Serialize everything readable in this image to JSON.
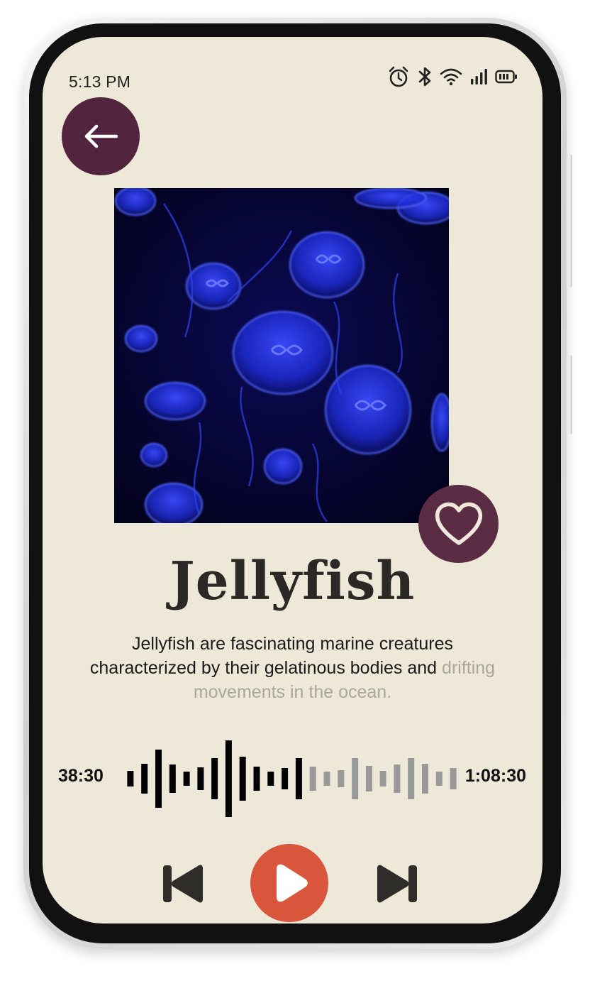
{
  "status_bar": {
    "time": "5:13 PM",
    "icons": [
      "alarm-icon",
      "bluetooth-icon",
      "wifi-icon",
      "signal-icon",
      "battery-icon"
    ]
  },
  "track": {
    "title": "Jellyfish",
    "description_start": "Jellyfish are fascinating marine creatures characterized by their gelatinous bodies and ",
    "description_faded": "drifting movements in the ocean.",
    "artwork": "jellyfish-photo"
  },
  "playback": {
    "elapsed": "38:30",
    "duration": "1:08:30",
    "progress": 0.56
  },
  "controls": {
    "back": "back-arrow-icon",
    "favorite": "heart-icon",
    "previous": "skip-previous-icon",
    "play": "play-icon",
    "next": "skip-next-icon"
  },
  "colors": {
    "background": "#eee8d8",
    "accent_dark": "#52243f",
    "play_button": "#d9553c",
    "waveform_played": "#000000",
    "waveform_remaining": "#999999"
  }
}
